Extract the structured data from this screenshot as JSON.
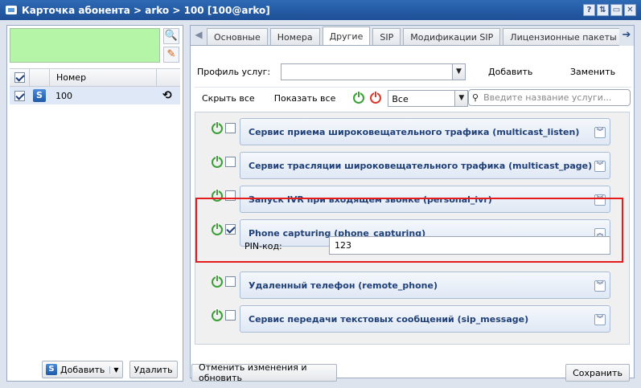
{
  "window": {
    "title": "Карточка абонента > arko > 100 [100@arko]",
    "buttons": [
      "?",
      "⇅",
      "▭",
      "✕"
    ]
  },
  "left": {
    "column_header": "Номер",
    "rows": [
      {
        "number": "100",
        "checked": true
      }
    ],
    "add_label": "Добавить",
    "delete_label": "Удалить"
  },
  "tabs": [
    "Основные",
    "Номера",
    "Другие",
    "SIP",
    "Модификации SIP",
    "Лицензионные пакеты ДВ"
  ],
  "active_tab": "Другие",
  "profile": {
    "label": "Профиль услуг:",
    "value": "",
    "add_label": "Добавить",
    "replace_label": "Заменить"
  },
  "toolbar": {
    "hide_all": "Скрыть все",
    "show_all": "Показать все",
    "filter_value": "Все",
    "search_placeholder": "Введите название услуги..."
  },
  "services": [
    {
      "title": "Сервис приема широковещательного трафика (multicast_listen)",
      "checked": false,
      "expanded": false
    },
    {
      "title": "Сервис трасляции широковещательного трафика (multicast_page)",
      "checked": false,
      "expanded": false
    },
    {
      "title": "Запуск IVR при входящем звонке (personal_ivr)",
      "checked": false,
      "expanded": false
    },
    {
      "title": "Phone capturing (phone_capturing)",
      "checked": true,
      "expanded": true,
      "field_label": "PIN-код:",
      "field_value": "123"
    },
    {
      "title": "Удаленный телефон (remote_phone)",
      "checked": false,
      "expanded": false
    },
    {
      "title": "Сервис передачи текстовых сообщений (sip_message)",
      "checked": false,
      "expanded": false
    }
  ],
  "footer": {
    "cancel_label": "Отменить изменения и обновить",
    "save_label": "Сохранить"
  },
  "colors": {
    "title_bar": "#2e6ab5",
    "highlight": "#e61c1c",
    "search_area": "#b5f5a8",
    "power_on": "#3aa035",
    "power_off": "#d93a2b"
  }
}
